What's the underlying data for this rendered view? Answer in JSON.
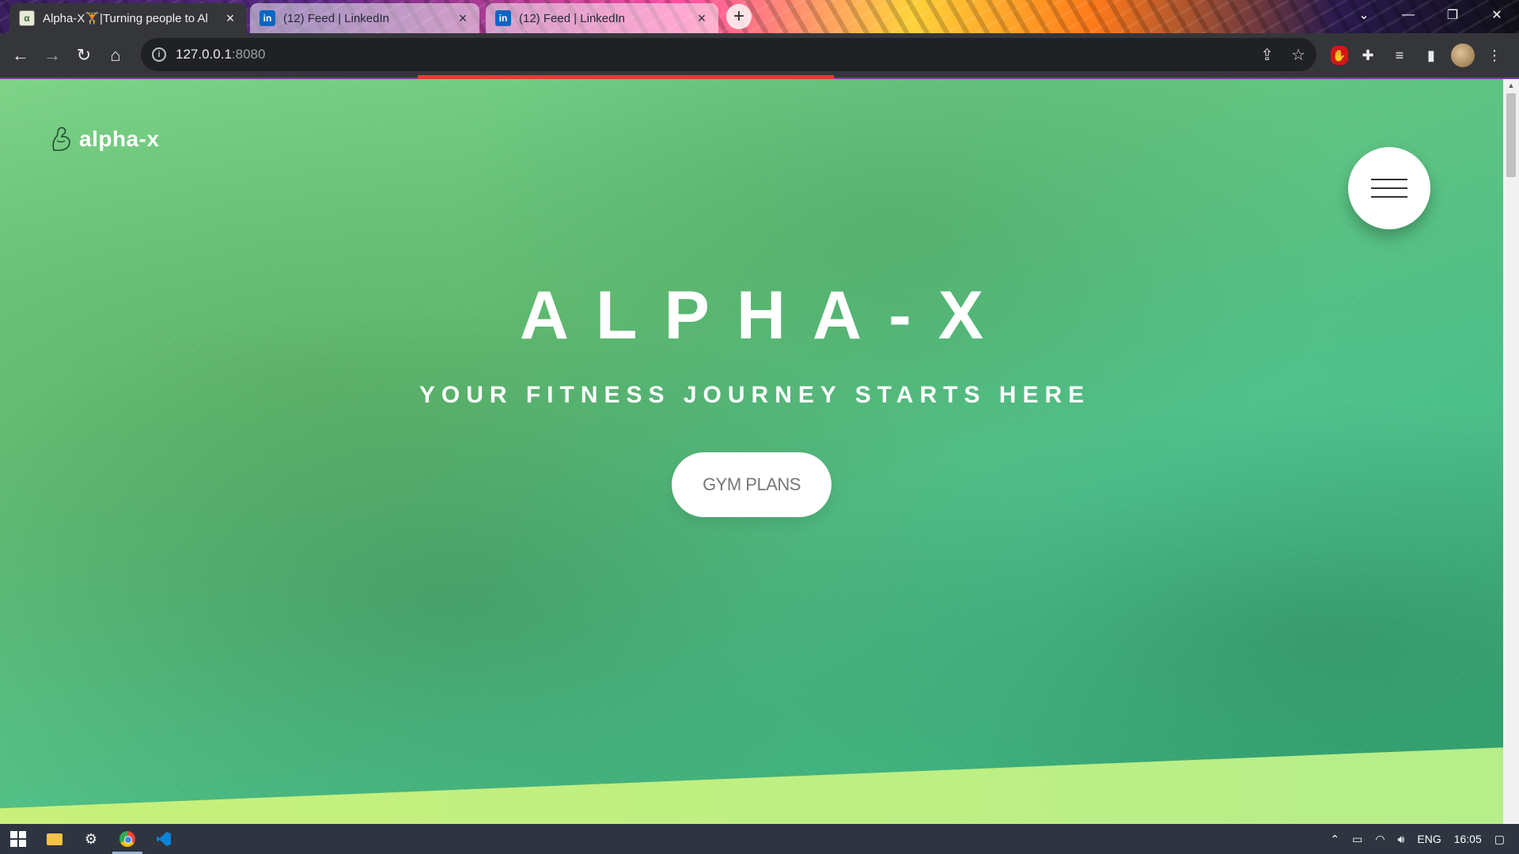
{
  "browser": {
    "tabs": [
      {
        "title": "Alpha-X🏋️|Turning people to Al",
        "favicon": "alpha-x-favicon",
        "active": true
      },
      {
        "title": "(12) Feed | LinkedIn",
        "favicon": "linkedin-favicon",
        "active": false
      },
      {
        "title": "(12) Feed | LinkedIn",
        "favicon": "linkedin-favicon",
        "active": false
      }
    ],
    "new_tab_label": "+",
    "address": {
      "host": "127.0.0.1",
      "port": ":8080"
    },
    "window_controls": [
      "chevron-down-icon",
      "minimize-icon",
      "restore-icon",
      "close-icon"
    ]
  },
  "page": {
    "logo_text": "alpha-x",
    "hero_title": "ALPHA-X",
    "hero_subtitle": "YOUR FITNESS JOURNEY STARTS HERE",
    "cta_label": "GYM PLANS",
    "colors": {
      "overlay_green": "#63c580",
      "accent_lime": "#c8f07a",
      "button_text": "#777777"
    }
  },
  "taskbar": {
    "tray": {
      "language": "ENG",
      "time": "16:05"
    }
  }
}
